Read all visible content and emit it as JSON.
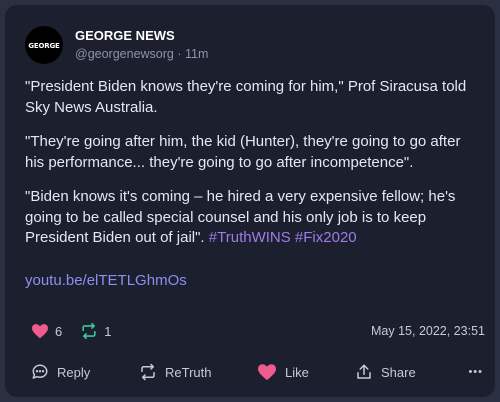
{
  "account": {
    "avatar_text": "GEORGE",
    "display_name": "GEORGE NEWS",
    "handle": "@georgenewsorg",
    "separator": "·",
    "age": "11m"
  },
  "post": {
    "paragraph1": "\"President Biden knows they're coming for him,\" Prof Siracusa told Sky News Australia.",
    "paragraph2": "\"They're going after him, the kid (Hunter), they're going to go after his performance... they're going to go after incompetence\".",
    "paragraph3_text": "\"Biden knows it's coming – he hired a very expensive fellow; he's going to be called special counsel and his only job is to keep President Biden out of jail\".",
    "hashtag1": "#TruthWINS",
    "hashtag2": "#Fix2020",
    "link": "youtu.be/elTETLGhmOs"
  },
  "stats": {
    "likes": "6",
    "retruths": "1",
    "timestamp": "May 15, 2022, 23:51"
  },
  "actions": {
    "reply": "Reply",
    "retruth": "ReTruth",
    "like": "Like",
    "share": "Share",
    "more": "•••"
  },
  "colors": {
    "like": "#ef5b8d",
    "retruth": "#3ec79a",
    "hashtag": "#a07be8",
    "link": "#8d8ff0"
  },
  "icons": {
    "like": "heart-icon",
    "retruth": "retruth-icon",
    "reply": "reply-bubble-icon",
    "share": "share-icon",
    "more": "more-icon"
  }
}
